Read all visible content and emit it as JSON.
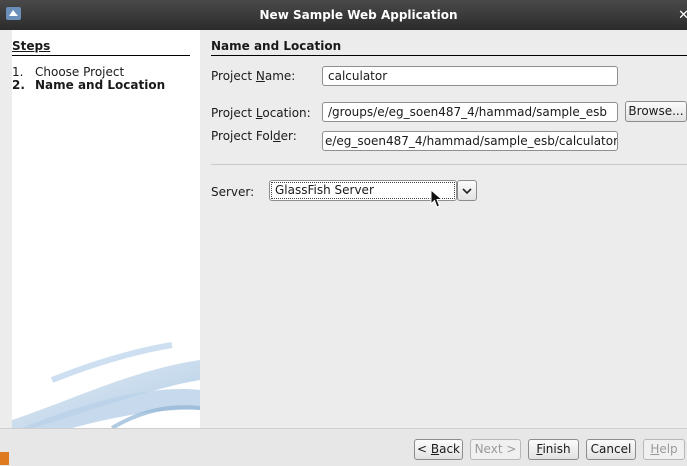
{
  "window": {
    "title": "New Sample Web Application",
    "icon": "netbeans-app-icon"
  },
  "steps": {
    "title": "Steps",
    "items": [
      {
        "num": "1.",
        "label": "Choose Project",
        "current": false
      },
      {
        "num": "2.",
        "label": "Name and Location",
        "current": true
      }
    ]
  },
  "section": {
    "title": "Name and Location"
  },
  "form": {
    "project_name": {
      "label_pre": "Project ",
      "mnemonic": "N",
      "label_post": "ame:",
      "value": "calculator"
    },
    "project_location": {
      "label_pre": "Project ",
      "mnemonic": "L",
      "label_post": "ocation:",
      "value": "/groups/e/eg_soen487_4/hammad/sample_esb"
    },
    "project_folder": {
      "label_pre": "Project Fol",
      "mnemonic": "d",
      "label_post": "er:",
      "value": "e/eg_soen487_4/hammad/sample_esb/calculator"
    },
    "browse_label": "Browse...",
    "server": {
      "label": "Server:",
      "selected": "GlassFish Server"
    }
  },
  "buttons": {
    "back": {
      "pre": "< ",
      "mnemonic": "B",
      "post": "ack"
    },
    "next": "Next >",
    "finish": {
      "pre": "",
      "mnemonic": "F",
      "post": "inish"
    },
    "cancel": "Cancel",
    "help": {
      "pre": "",
      "mnemonic": "H",
      "post": "elp"
    }
  },
  "colors": {
    "titlebar": "#2b2b2b",
    "panel_bg": "#ffffff",
    "dialog_bg": "#ececec"
  }
}
